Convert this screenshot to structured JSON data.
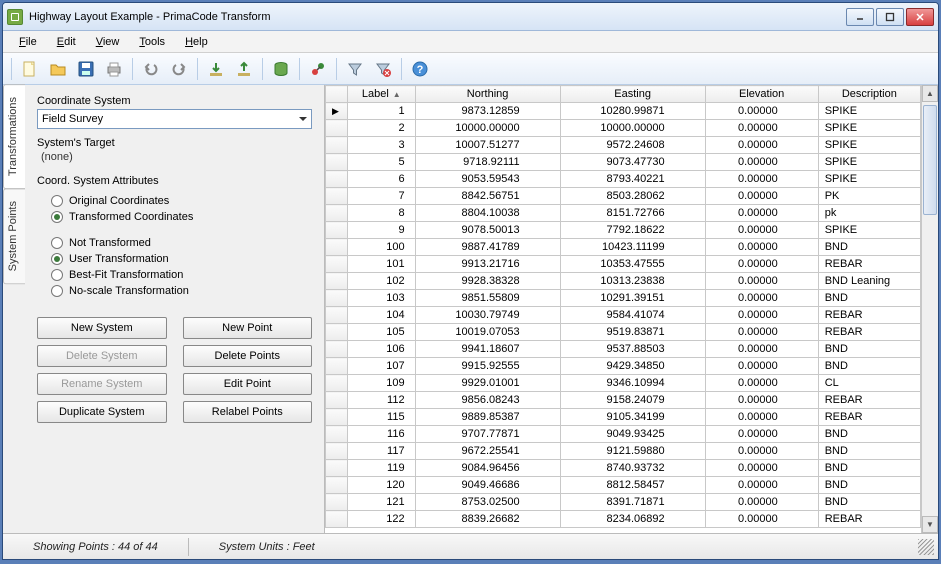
{
  "window": {
    "title": "Highway Layout Example - PrimaCode Transform"
  },
  "menu": {
    "file": "File",
    "edit": "Edit",
    "view": "View",
    "tools": "Tools",
    "help": "Help"
  },
  "sidetabs": {
    "transformations": "Transformations",
    "systempoints": "System Points"
  },
  "panel": {
    "coord_system_lbl": "Coordinate System",
    "coord_system_val": "Field Survey",
    "target_lbl": "System's Target",
    "target_val": "(none)",
    "attrs_lbl": "Coord. System Attributes",
    "orig": "Original Coordinates",
    "transf": "Transformed Coordinates",
    "nottrans": "Not Transformed",
    "usertrans": "User Transformation",
    "bestfit": "Best-Fit Transformation",
    "noscale": "No-scale Transformation",
    "btn_newsys": "New System",
    "btn_newpt": "New Point",
    "btn_delsys": "Delete System",
    "btn_delpts": "Delete Points",
    "btn_rensys": "Rename System",
    "btn_editpt": "Edit Point",
    "btn_dupsys": "Duplicate System",
    "btn_relab": "Relabel Points"
  },
  "grid": {
    "headers": {
      "label": "Label",
      "northing": "Northing",
      "easting": "Easting",
      "elevation": "Elevation",
      "description": "Description"
    },
    "rows": [
      {
        "label": "1",
        "n": "9873.12859",
        "e": "10280.99871",
        "el": "0.00000",
        "d": "SPIKE"
      },
      {
        "label": "2",
        "n": "10000.00000",
        "e": "10000.00000",
        "el": "0.00000",
        "d": "SPIKE"
      },
      {
        "label": "3",
        "n": "10007.51277",
        "e": "9572.24608",
        "el": "0.00000",
        "d": "SPIKE"
      },
      {
        "label": "5",
        "n": "9718.92111",
        "e": "9073.47730",
        "el": "0.00000",
        "d": "SPIKE"
      },
      {
        "label": "6",
        "n": "9053.59543",
        "e": "8793.40221",
        "el": "0.00000",
        "d": "SPIKE"
      },
      {
        "label": "7",
        "n": "8842.56751",
        "e": "8503.28062",
        "el": "0.00000",
        "d": "PK"
      },
      {
        "label": "8",
        "n": "8804.10038",
        "e": "8151.72766",
        "el": "0.00000",
        "d": "pk"
      },
      {
        "label": "9",
        "n": "9078.50013",
        "e": "7792.18622",
        "el": "0.00000",
        "d": "SPIKE"
      },
      {
        "label": "100",
        "n": "9887.41789",
        "e": "10423.11199",
        "el": "0.00000",
        "d": "BND"
      },
      {
        "label": "101",
        "n": "9913.21716",
        "e": "10353.47555",
        "el": "0.00000",
        "d": "REBAR"
      },
      {
        "label": "102",
        "n": "9928.38328",
        "e": "10313.23838",
        "el": "0.00000",
        "d": "BND Leaning"
      },
      {
        "label": "103",
        "n": "9851.55809",
        "e": "10291.39151",
        "el": "0.00000",
        "d": "BND"
      },
      {
        "label": "104",
        "n": "10030.79749",
        "e": "9584.41074",
        "el": "0.00000",
        "d": "REBAR"
      },
      {
        "label": "105",
        "n": "10019.07053",
        "e": "9519.83871",
        "el": "0.00000",
        "d": "REBAR"
      },
      {
        "label": "106",
        "n": "9941.18607",
        "e": "9537.88503",
        "el": "0.00000",
        "d": "BND"
      },
      {
        "label": "107",
        "n": "9915.92555",
        "e": "9429.34850",
        "el": "0.00000",
        "d": "BND"
      },
      {
        "label": "109",
        "n": "9929.01001",
        "e": "9346.10994",
        "el": "0.00000",
        "d": "CL"
      },
      {
        "label": "112",
        "n": "9856.08243",
        "e": "9158.24079",
        "el": "0.00000",
        "d": "REBAR"
      },
      {
        "label": "115",
        "n": "9889.85387",
        "e": "9105.34199",
        "el": "0.00000",
        "d": "REBAR"
      },
      {
        "label": "116",
        "n": "9707.77871",
        "e": "9049.93425",
        "el": "0.00000",
        "d": "BND"
      },
      {
        "label": "117",
        "n": "9672.25541",
        "e": "9121.59880",
        "el": "0.00000",
        "d": "BND"
      },
      {
        "label": "119",
        "n": "9084.96456",
        "e": "8740.93732",
        "el": "0.00000",
        "d": "BND"
      },
      {
        "label": "120",
        "n": "9049.46686",
        "e": "8812.58457",
        "el": "0.00000",
        "d": "BND"
      },
      {
        "label": "121",
        "n": "8753.02500",
        "e": "8391.71871",
        "el": "0.00000",
        "d": "BND"
      },
      {
        "label": "122",
        "n": "8839.26682",
        "e": "8234.06892",
        "el": "0.00000",
        "d": "REBAR"
      }
    ]
  },
  "status": {
    "showing": "Showing Points :  44 of 44",
    "units": "System Units :  Feet"
  }
}
